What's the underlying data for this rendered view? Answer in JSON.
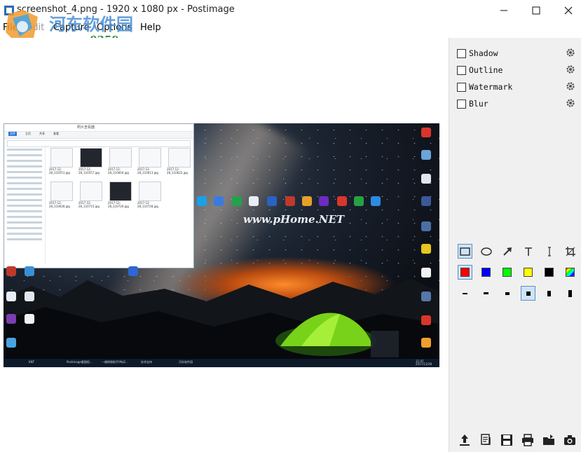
{
  "window": {
    "title": "screenshot_4.png - 1920 x 1080 px - Postimage",
    "controls": [
      "minimize",
      "maximize",
      "close"
    ]
  },
  "menu": [
    "File",
    "Edit",
    "Capture",
    "Options",
    "Help"
  ],
  "watermark": {
    "site_name": "河东软件园",
    "url": "www.pc0359.cn"
  },
  "effects": [
    {
      "label": "Shadow",
      "checked": false
    },
    {
      "label": "Outline",
      "checked": false
    },
    {
      "label": "Watermark",
      "checked": false
    },
    {
      "label": "Blur",
      "checked": false
    }
  ],
  "tools": {
    "shapes": [
      "rectangle-icon",
      "ellipse-icon",
      "arrow-icon",
      "text-icon",
      "cursor-text-icon",
      "crop-icon"
    ],
    "selected_shape": "rectangle-icon",
    "colors": [
      "#ff0000",
      "#0000ff",
      "#00ff00",
      "#ffff00",
      "#000000",
      "gradient"
    ],
    "selected_color": "#ff0000",
    "line_widths": [
      "thin",
      "thin-medium",
      "medium",
      "thick",
      "thicker",
      "thickest"
    ],
    "selected_width": "thick"
  },
  "bottom_actions": [
    "upload-icon",
    "copy-document-icon",
    "save-icon",
    "print-icon",
    "open-folder-icon",
    "camera-icon"
  ],
  "screenshot": {
    "explorer_title": "照片查看器",
    "tab_labels": [
      "文件",
      "主页",
      "共享",
      "查看"
    ],
    "center_watermark": "www.pHome.NET",
    "files": [
      "2017-12-28_110551.jpg",
      "2017-12-28_110557.jpg",
      "2017-12-28_110604.jpg",
      "2017-12-28_110613.jpg",
      "2017-12-28_110622.jpg",
      "2017-12-28_110628.jpg",
      "2017-12-28_110715.jpg",
      "2017-12-28_110720.jpg",
      "2017-12-28_110728.jpg"
    ],
    "nav_items": [
      "快速访问",
      "桌面",
      "下载",
      "文档",
      "图片",
      "APK",
      "NotePro",
      "软件截图",
      "河东软件园",
      "OneDrive",
      "此电脑",
      "视频",
      "图片",
      "文档",
      "下载",
      "音乐",
      "桌面",
      "本地磁盘 (C:)",
      "本地磁盘 (D:)"
    ],
    "desktop_right_icons": [
      "FSCapture",
      "Mykeebolt Watermarker",
      "新建文本档",
      "IObit Uninstaller",
      "OBIEE Network",
      "ImageMag Display",
      "ImageBox - 快捷方式",
      "iReeSoft Image R...",
      "Yandex",
      "UC浏览器"
    ],
    "taskbar_items": [
      "KNT",
      "Postimage截图程...",
      "一键转换助手(MyE...",
      "技术支持",
      "河东软件园"
    ],
    "taskbar_clock": "11:07\n2017/12/28"
  }
}
